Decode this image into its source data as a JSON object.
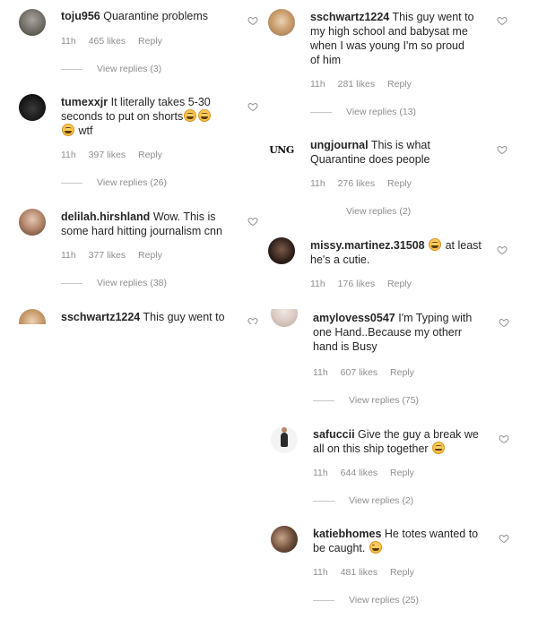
{
  "left_column": [
    {
      "id": "toju",
      "username": "toju956",
      "text": "Quarantine problems",
      "time": "11h",
      "likes": "465 likes",
      "reply": "Reply",
      "view_replies": "View replies (3)"
    },
    {
      "id": "tumex",
      "username": "tumexxjr",
      "text_line1": "It literally takes 5-30",
      "text_line2": "seconds to put on shorts",
      "text_line3": "wtf",
      "time": "11h",
      "likes": "397 likes",
      "reply": "Reply",
      "view_replies": "View replies (26)"
    },
    {
      "id": "delilah",
      "username": "delilah.hirshland",
      "text_line1": "Wow. This is",
      "text_line2": "some hard hitting journalism cnn",
      "time": "11h",
      "likes": "377 likes",
      "reply": "Reply",
      "view_replies": "View replies (38)"
    },
    {
      "id": "ssch_partial",
      "username": "sschwartz1224",
      "text": "This guy went to"
    }
  ],
  "right_column": [
    {
      "id": "ssch",
      "username": "sschwartz1224",
      "text_line1": "This guy went to",
      "text_line2": "my high school and babysat me",
      "text_line3": "when I was young I'm so proud",
      "text_line4": "of him",
      "time": "11h",
      "likes": "281 likes",
      "reply": "Reply",
      "view_replies": "View replies (13)"
    },
    {
      "id": "ung",
      "username": "ungjournal",
      "avatar_text": "UNG",
      "text_line1": "This is what",
      "text_line2": "Quarantine does people",
      "time": "11h",
      "likes": "276 likes",
      "reply": "Reply",
      "view_replies": "View replies (2)"
    },
    {
      "id": "missy",
      "username": "missy.martinez.31508",
      "text_line1": "at least",
      "text_line2": "he's a cutie.",
      "time": "11h",
      "likes": "176 likes",
      "reply": "Reply"
    },
    {
      "id": "amy",
      "username": "amylovess0547",
      "text_line1": "I'm Typing with",
      "text_line2": "one Hand..Because my otherr",
      "text_line3": "hand is Busy",
      "time": "11h",
      "likes": "607 likes",
      "reply": "Reply",
      "view_replies": "View replies (75)"
    },
    {
      "id": "saf",
      "username": "safuccii",
      "text_line1": "Give the guy a break we",
      "text_line2": "all on this ship together",
      "time": "11h",
      "likes": "644 likes",
      "reply": "Reply",
      "view_replies": "View replies (2)"
    },
    {
      "id": "katie",
      "username": "katiebhomes",
      "text_line1": "He totes wanted to",
      "text_line2": "be caught.",
      "time": "11h",
      "likes": "481 likes",
      "reply": "Reply",
      "view_replies": "View replies (25)"
    }
  ],
  "icons": {
    "like": "heart-outline-icon",
    "emoji_laugh": "laughing-emoji-icon",
    "emoji_smile": "grinning-emoji-icon",
    "emoji_wink": "winking-emoji-icon"
  },
  "colors": {
    "text": "#262626",
    "meta": "#8e8e8e",
    "divider": "#c7c7c7",
    "background": "#ffffff"
  }
}
